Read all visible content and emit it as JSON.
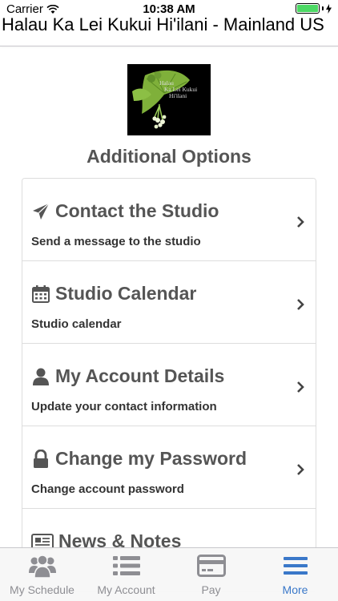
{
  "status_bar": {
    "carrier": "Carrier",
    "time": "10:38 AM"
  },
  "nav": {
    "title": "Halau Ka Lei Kukui Hi'ilani - Mainland US"
  },
  "logo": {
    "text_line1": "Halau",
    "text_line2": "Ka Lei Kukui",
    "text_line3": "Hi'ilani"
  },
  "heading": "Additional Options",
  "options": [
    {
      "title": "Contact the Studio",
      "subtitle": "Send a message to the studio",
      "icon": "paper-plane-icon"
    },
    {
      "title": "Studio Calendar",
      "subtitle": "Studio calendar",
      "icon": "calendar-icon"
    },
    {
      "title": "My Account Details",
      "subtitle": "Update your contact information",
      "icon": "user-icon"
    },
    {
      "title": "Change my Password",
      "subtitle": "Change account password",
      "icon": "lock-icon"
    },
    {
      "title": "News & Notes",
      "subtitle": "",
      "icon": "newspaper-icon"
    }
  ],
  "tabs": [
    {
      "label": "My Schedule",
      "icon": "group-icon",
      "active": false
    },
    {
      "label": "My Account",
      "icon": "list-icon",
      "active": false
    },
    {
      "label": "Pay",
      "icon": "credit-card-icon",
      "active": false
    },
    {
      "label": "More",
      "icon": "menu-icon",
      "active": true
    }
  ],
  "colors": {
    "accent": "#3a78c9",
    "tab_inactive": "#8e8e93",
    "battery": "#4cd964"
  }
}
